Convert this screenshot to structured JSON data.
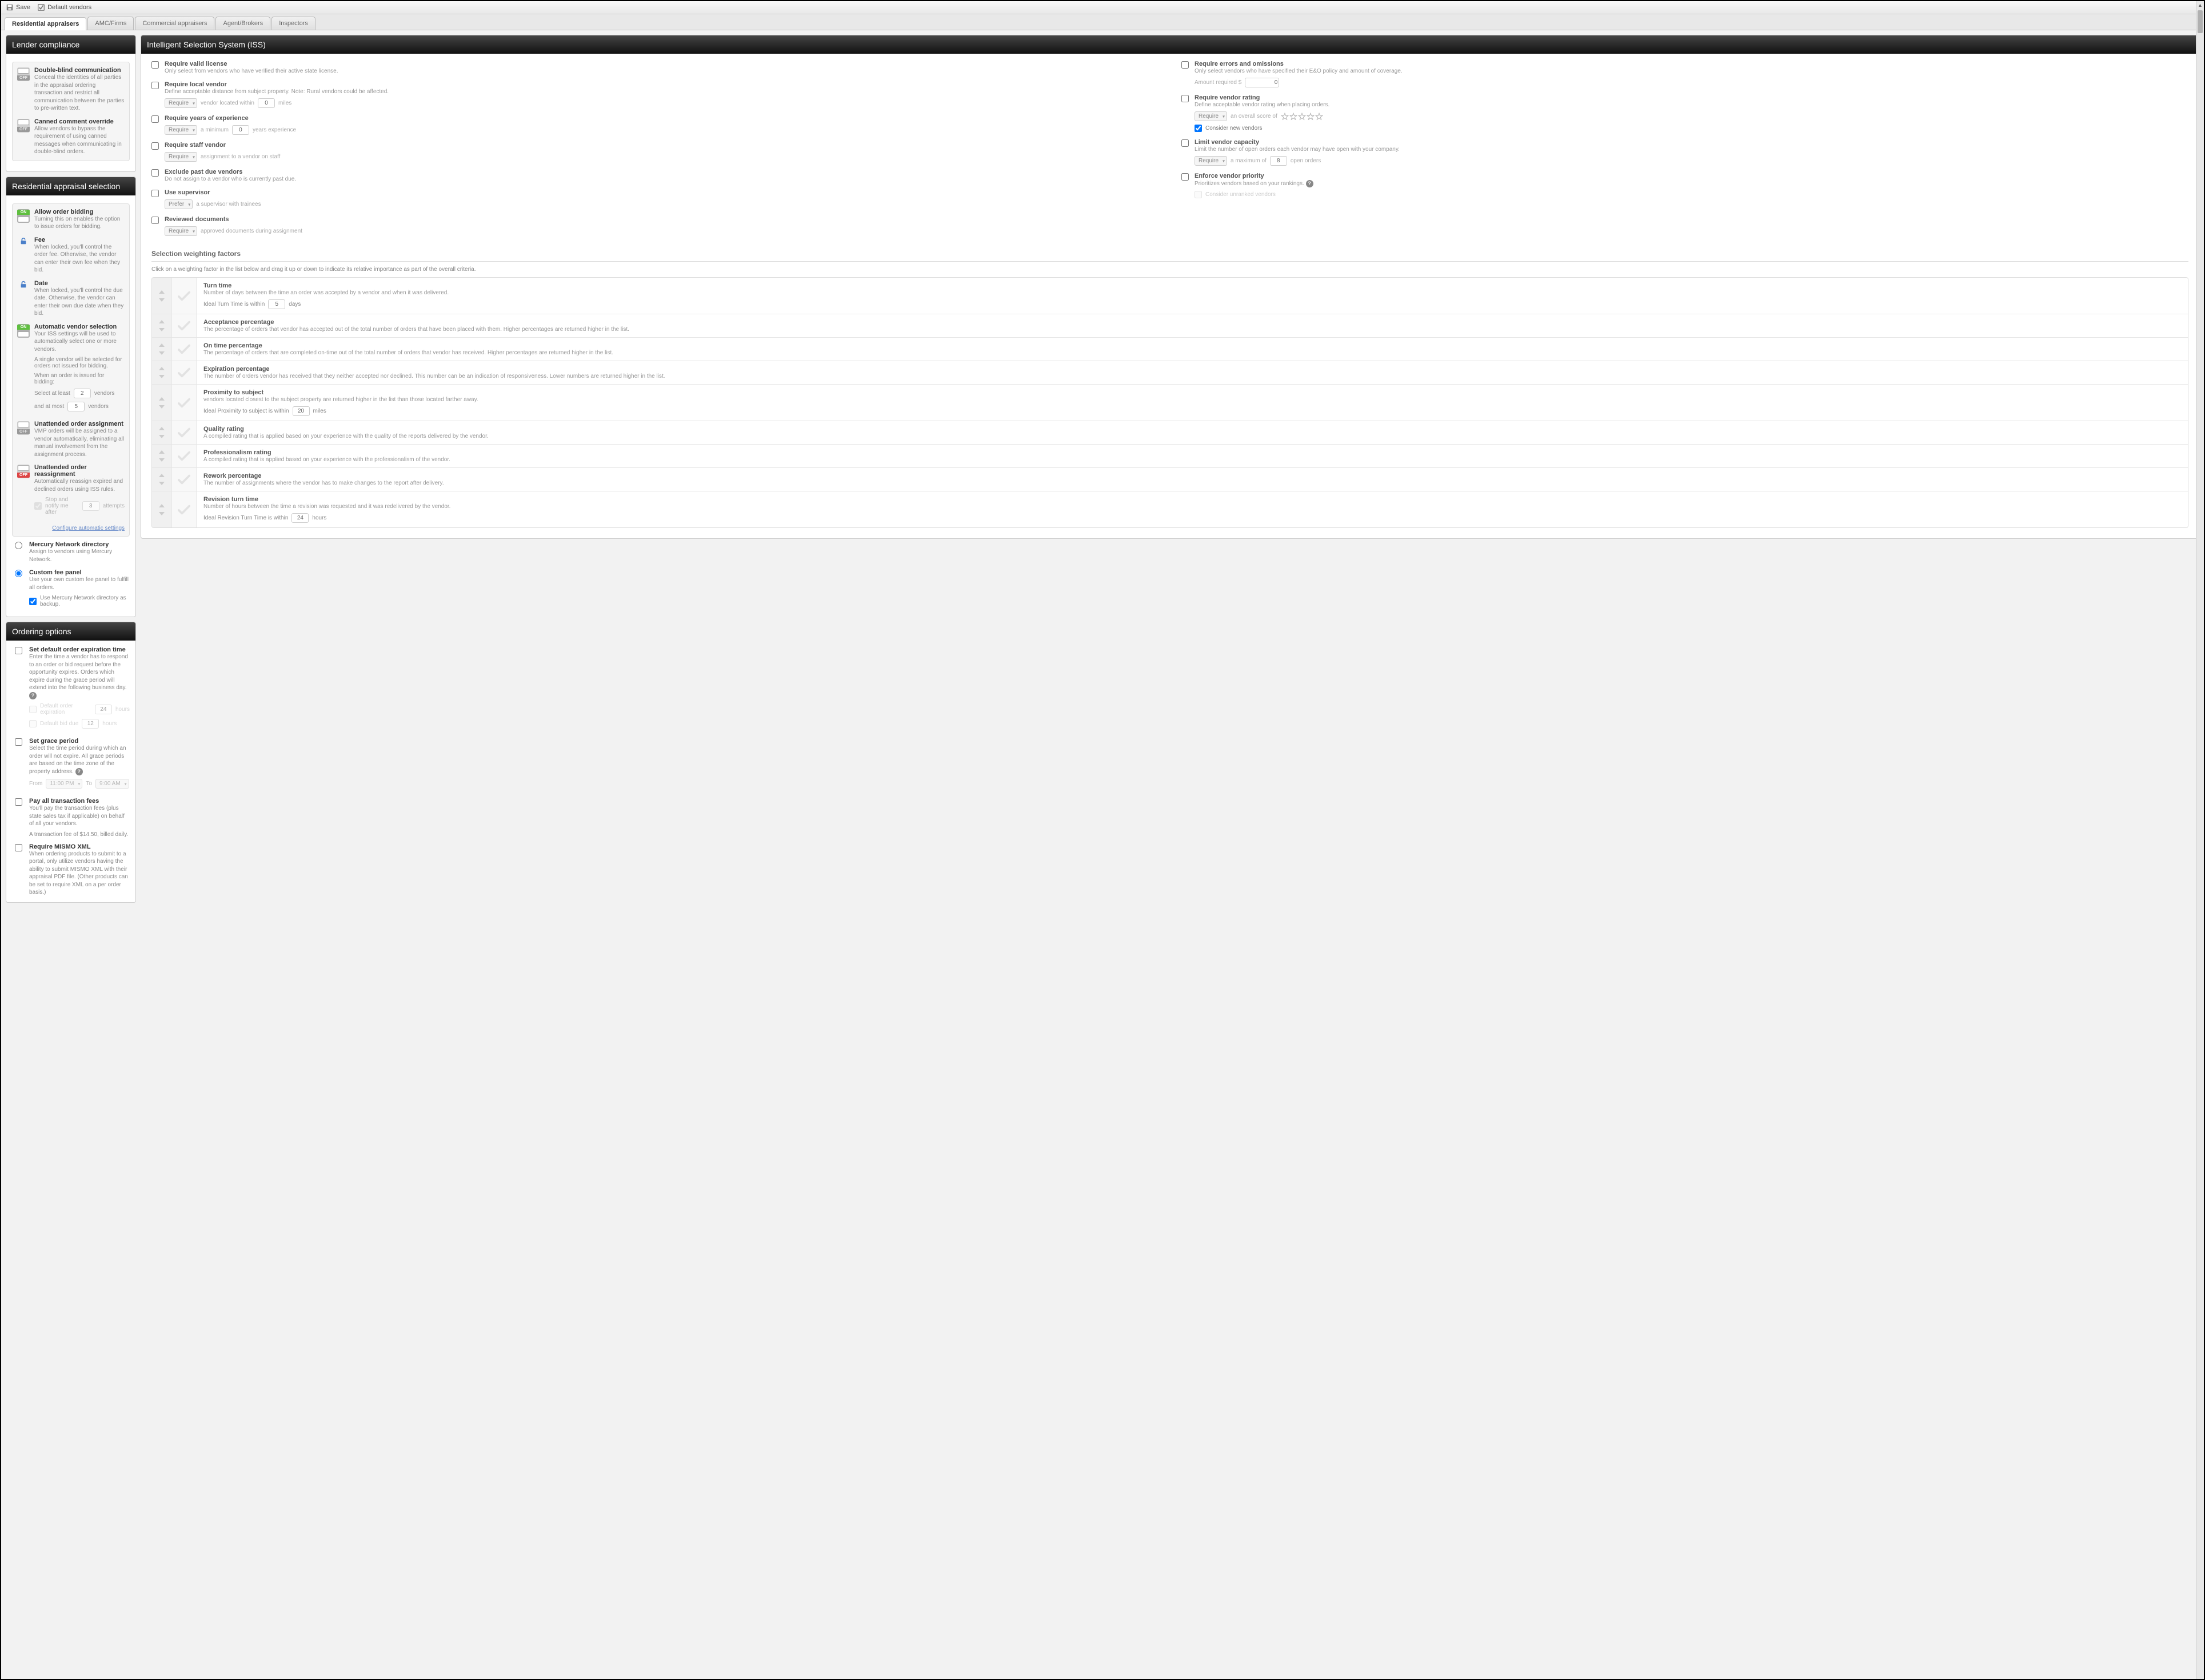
{
  "toolbar": {
    "save": "Save",
    "default_vendors": "Default vendors"
  },
  "tabs": [
    "Residential appraisers",
    "AMC/Firms",
    "Commercial appraisers",
    "Agent/Brokers",
    "Inspectors"
  ],
  "active_tab": 0,
  "lender": {
    "title": "Lender compliance",
    "dbc": {
      "title": "Double-blind communication",
      "desc": "Conceal the identities of all parties in the appraisal ordering transaction and restrict all communication between the parties to pre-written text."
    },
    "cco": {
      "title": "Canned comment override",
      "desc": "Allow vendors to bypass the requirement of using canned messages when communicating in double-blind orders."
    }
  },
  "ras": {
    "title": "Residential appraisal selection",
    "allow_bid": {
      "title": "Allow order bidding",
      "desc": "Turning this on enables the option to issue orders for bidding."
    },
    "fee": {
      "title": "Fee",
      "desc": "When locked, you'll control the order fee. Otherwise, the vendor can enter their own fee when they bid."
    },
    "date": {
      "title": "Date",
      "desc": "When locked, you'll control the due date. Otherwise, the vendor can enter their own due date when they bid."
    },
    "avs": {
      "title": "Automatic vendor selection",
      "desc": "Your ISS settings will be used to automatically select one or more vendors.",
      "extra1": "A single vendor will be selected for orders not issued for bidding.",
      "extra2": "When an order is issued for bidding:",
      "sel_least": "Select at least",
      "sel_least_val": "2",
      "sel_least_suf": "vendors",
      "sel_most": "and at most",
      "sel_most_val": "5",
      "sel_most_suf": "vendors"
    },
    "uoa": {
      "title": "Unattended order assignment",
      "desc": "VMP orders will be assigned to a vendor automatically, eliminating all manual involvement from the assignment process."
    },
    "uor": {
      "title": "Unattended order reassignment",
      "desc": "Automatically reassign expired and declined orders using ISS rules.",
      "stop": "Stop and notify me after",
      "stop_val": "3",
      "stop_suf": "attempts"
    },
    "cas_link": "Configure automatic settings",
    "mnd": {
      "title": "Mercury Network directory",
      "desc": "Assign to vendors using Mercury Network."
    },
    "cfp": {
      "title": "Custom fee panel",
      "desc": "Use your own custom fee panel to fulfill all orders.",
      "backup": "Use Mercury Network directory as backup."
    }
  },
  "ordering": {
    "title": "Ordering options",
    "sdoe": {
      "title": "Set default order expiration time",
      "desc": "Enter the time a vendor has to respond to an order or bid request before the opportunity expires. Orders which expire during the grace period will extend into the following business day.",
      "doe": "Default order expiration",
      "doe_val": "24",
      "doe_unit": "hours",
      "dbd": "Default bid due",
      "dbd_val": "12",
      "dbd_unit": "hours"
    },
    "sgp": {
      "title": "Set grace period",
      "desc": "Select the time period during which an order will not expire. All grace periods are based on the time zone of the property address.",
      "from": "From",
      "from_val": "11:00 PM",
      "to": "To",
      "to_val": "9:00 AM"
    },
    "ptf": {
      "title": "Pay all transaction fees",
      "desc": "You'll pay the transaction fees (plus state sales tax if applicable) on behalf of all your vendors.",
      "note": "A transaction fee of $14.50, billed daily."
    },
    "rmx": {
      "title": "Require MISMO XML",
      "desc": "When ordering products to submit to a portal, only utilize vendors having the ability to submit MISMO XML with their appraisal PDF file. (Other products can be set to require XML on a per order basis.)"
    }
  },
  "iss": {
    "title": "Intelligent Selection System (ISS)",
    "left": {
      "rvl": {
        "title": "Require valid license",
        "desc": "Only select from vendors who have verified their active state license."
      },
      "rlv": {
        "title": "Require local vendor",
        "desc": "Define acceptable distance from subject property. Note: Rural vendors could be affected.",
        "sel": "Require",
        "mid": "vendor located within",
        "val": "0",
        "unit": "miles"
      },
      "rye": {
        "title": "Require years of experience",
        "sel": "Require",
        "mid": "a minimum",
        "val": "0",
        "unit": "years experience"
      },
      "rsv": {
        "title": "Require staff vendor",
        "sel": "Require",
        "mid": "assignment to a vendor on staff"
      },
      "epd": {
        "title": "Exclude past due vendors",
        "desc": "Do not assign to a vendor who is currently past due."
      },
      "us": {
        "title": "Use supervisor",
        "sel": "Prefer",
        "mid": "a supervisor with trainees"
      },
      "rd": {
        "title": "Reviewed documents",
        "sel": "Require",
        "mid": "approved documents during assignment"
      }
    },
    "right": {
      "reo": {
        "title": "Require errors and omissions",
        "desc": "Only select vendors who have specified their E&O policy and amount of coverage.",
        "amt": "Amount required $",
        "val": "0"
      },
      "rvr": {
        "title": "Require vendor rating",
        "desc": "Define acceptable vendor rating when placing orders.",
        "sel": "Require",
        "mid": "an overall score of",
        "cnv": "Consider new vendors"
      },
      "lvc": {
        "title": "Limit vendor capacity",
        "desc": "Limit the number of open orders each vendor may have open with your company.",
        "sel": "Require",
        "mid": "a maximum of",
        "val": "8",
        "unit": "open orders"
      },
      "evp": {
        "title": "Enforce vendor priority",
        "desc": "Prioritizes vendors based on your rankings.",
        "cuv": "Consider unranked vendors"
      }
    }
  },
  "swf": {
    "title": "Selection weighting factors",
    "note": "Click on a weighting factor in the list below and drag it up or down to indicate its relative importance as part of the overall criteria.",
    "items": [
      {
        "t": "Turn time",
        "d": "Number of days between the time an order was accepted by a vendor and when it was delivered.",
        "x_pre": "Ideal Turn Time is within",
        "x_val": "5",
        "x_unit": "days"
      },
      {
        "t": "Acceptance percentage",
        "d": "The percentage of orders that vendor has accepted out of the total number of orders that have been placed with them. Higher percentages are returned higher in the list."
      },
      {
        "t": "On time percentage",
        "d": "The percentage of orders that are completed on-time out of the total number of orders that vendor has received. Higher percentages are returned higher in the list."
      },
      {
        "t": "Expiration percentage",
        "d": "The number of orders vendor has received that they neither accepted nor declined. This number can be an indication of responsiveness. Lower numbers are returned higher in the list."
      },
      {
        "t": "Proximity to subject",
        "d": "vendors located closest to the subject property are returned higher in the list than those located farther away.",
        "x_pre": "Ideal Proximity to subject is within",
        "x_val": "20",
        "x_unit": "miles"
      },
      {
        "t": "Quality rating",
        "d": "A compiled rating that is applied based on your experience with the quality of the reports delivered by the vendor."
      },
      {
        "t": "Professionalism rating",
        "d": "A compiled rating that is applied based on your experience with the professionalism of the vendor."
      },
      {
        "t": "Rework percentage",
        "d": "The number of assignments where the vendor has to make changes to the report after delivery."
      },
      {
        "t": "Revision turn time",
        "d": "Number of hours between the time a revision was requested and it was redelivered by the vendor.",
        "x_pre": "Ideal Revision Turn Time is within",
        "x_val": "24",
        "x_unit": "hours"
      }
    ]
  }
}
